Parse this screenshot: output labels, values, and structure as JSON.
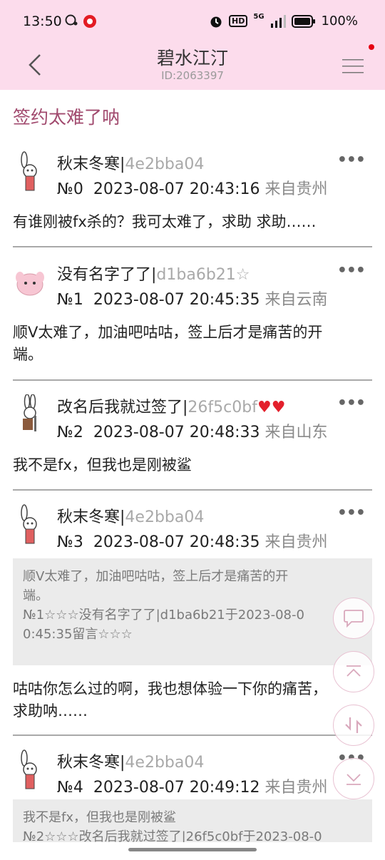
{
  "status_bar": {
    "time": "13:50",
    "battery": "100%",
    "network": "5G",
    "hd": "HD"
  },
  "header": {
    "title": "碧水江汀",
    "subtitle": "ID:2063397"
  },
  "thread": {
    "title": "签约太难了呐"
  },
  "posts": [
    {
      "name": "秋末冬寒|",
      "hash": "4e2bba04",
      "num": "№0",
      "datetime": "2023-08-07 20:43:16",
      "loc": "来自贵州",
      "body": "有谁刚被fx杀的？我可太难了，求助 求助……"
    },
    {
      "name": "没有名字了了|",
      "hash": "d1ba6b21☆",
      "num": "№1",
      "datetime": "2023-08-07 20:45:35",
      "loc": "来自云南",
      "body_lines": [
        "顺V太难了，加油吧咕咕，签上后才是痛苦的开",
        "端。"
      ]
    },
    {
      "name": "改名后我就过签了|",
      "hash": "26f5c0bf",
      "hearts": "♥♥",
      "num": "№2",
      "datetime": "2023-08-07 20:48:33",
      "loc": "来自山东",
      "body": "我不是fx，但我也是刚被鲨"
    },
    {
      "name": "秋末冬寒|",
      "hash": "4e2bba04",
      "num": "№3",
      "datetime": "2023-08-07 20:48:35",
      "loc": "来自贵州",
      "quote_lines": [
        "顺V太难了，加油吧咕咕，签上后才是痛苦的开",
        "端。",
        "№1☆☆☆没有名字了了|d1ba6b21于2023-08-0",
        "0:45:35留言☆☆☆"
      ],
      "body_lines": [
        "咕咕你怎么过的啊，我也想体验一下你的痛苦，",
        "求助呐……"
      ]
    },
    {
      "name": "秋末冬寒|",
      "hash": "4e2bba04",
      "num": "№4",
      "datetime": "2023-08-07 20:49:12",
      "loc": "来自贵州",
      "quote_lines": [
        "我不是fx，但我也是刚被鲨",
        "№2☆☆☆改名后我就过签了|26f5c0bf于2023-08-0"
      ]
    }
  ],
  "more_label": "•••",
  "icons": {
    "back": "chevron-left-icon",
    "menu": "hamburger-menu-icon",
    "comment": "comment-bubble-icon",
    "top": "scroll-top-icon",
    "refresh": "refresh-icon",
    "bottom": "scroll-bottom-icon"
  },
  "colors": {
    "header_bg": "#fcdcec",
    "thread_title": "#a14a6e",
    "hash": "#a9a9a9",
    "location": "#8a8a8a",
    "quote_bg": "#ebebeb",
    "heart": "#e3202c"
  }
}
